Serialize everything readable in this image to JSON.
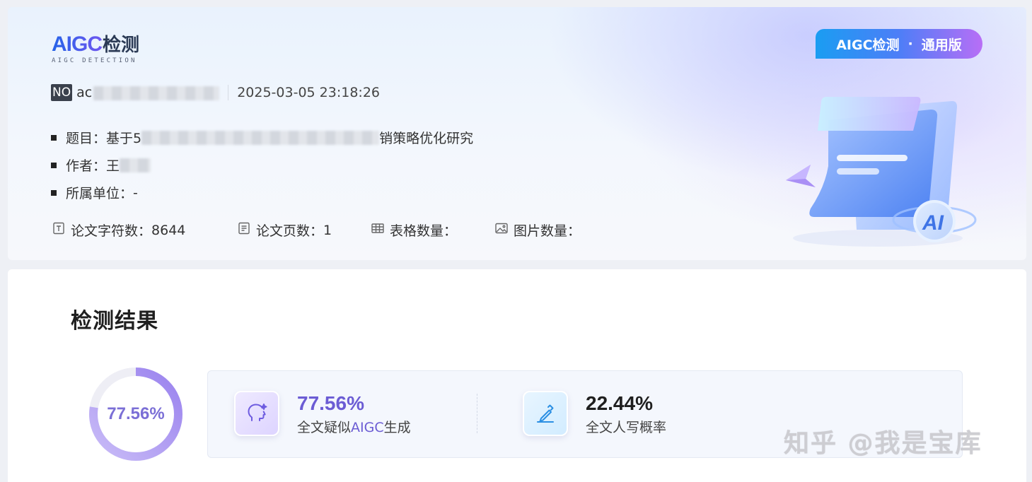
{
  "header": {
    "logo": {
      "main": "AIGC",
      "cn": "检测",
      "sub": "AIGC DETECTION"
    },
    "badge": {
      "left": "AIGC检测",
      "dot": "·",
      "right": "通用版"
    },
    "no_tag": "NO",
    "no_id_prefix": "ac",
    "datetime": "2025-03-05 23:18:26",
    "info": [
      {
        "label": "题目：",
        "value_start": "基于5",
        "value_end": "销策略优化研究"
      },
      {
        "label": "作者：",
        "value_start": "王",
        "value_end": ""
      },
      {
        "label": "所属单位：",
        "value_start": "-",
        "value_end": ""
      }
    ],
    "stats": [
      {
        "icon": "document-text-icon",
        "label": "论文字符数：",
        "value": "8644"
      },
      {
        "icon": "document-pages-icon",
        "label": "论文页数：",
        "value": "1"
      },
      {
        "icon": "table-icon",
        "label": "表格数量：",
        "value": ""
      },
      {
        "icon": "image-icon",
        "label": "图片数量：",
        "value": ""
      }
    ]
  },
  "result": {
    "title": "检测结果",
    "ring_label": "77.56%",
    "ring_fraction": 0.7756,
    "aigc": {
      "value": "77.56%",
      "desc_pre": "全文疑似",
      "desc_hl": "AIGC",
      "desc_post": "生成",
      "color": "#6b5cd4"
    },
    "human": {
      "value": "22.44%",
      "desc": "全文人写概率",
      "color": "#1f1f1f"
    }
  },
  "watermark": "知乎 @我是宝库",
  "colors": {
    "accent": "#6b5cd4",
    "ring_start": "#b7a6f3",
    "ring_end": "#9b84ee",
    "ring_track": "#eeeef5"
  }
}
